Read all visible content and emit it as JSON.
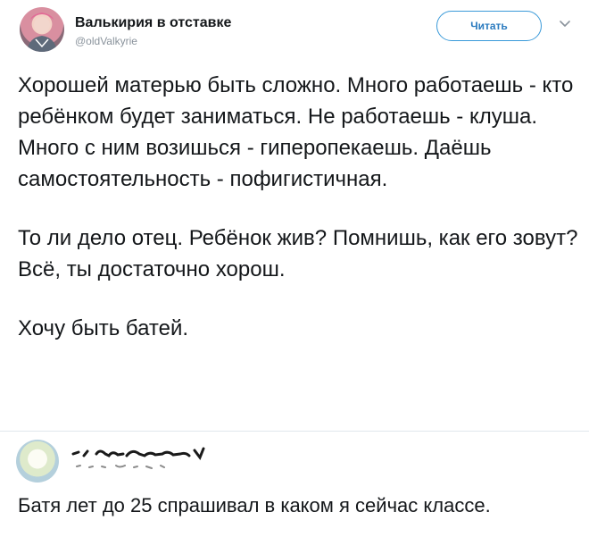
{
  "tweet": {
    "author": {
      "display_name": "Валькирия в отставке",
      "handle": "@oldValkyrie"
    },
    "follow_label": "Читать",
    "paragraphs": [
      "Хорошей матерью быть сложно. Много работаешь - кто ребёнком будет заниматься. Не работаешь - клуша. Много с ним возишься - гиперопекаешь. Даёшь самостоятельность - пофигистичная.",
      "То ли дело отец. Ребёнок жив? Помнишь, как его зовут? Всё, ты достаточно хорош.",
      "Хочу быть батей."
    ]
  },
  "reply": {
    "text": "Батя лет до 25 спрашивал в каком я сейчас классе."
  },
  "icons": {
    "menu": "chevron-down-icon",
    "author_avatar": "avatar",
    "reply_avatar": "avatar",
    "redacted_name": "scribble-redaction"
  },
  "colors": {
    "follow_border": "#3a9ad9",
    "follow_text": "#2b7bbf",
    "handle": "#8a939c",
    "divider": "#e1e8ed"
  }
}
